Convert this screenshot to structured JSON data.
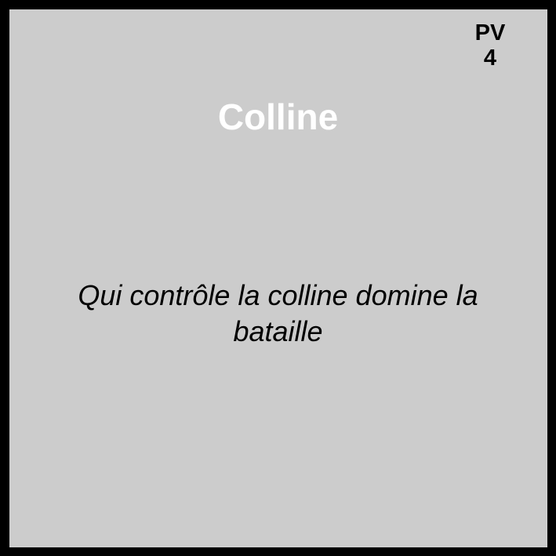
{
  "card": {
    "title": "Colline",
    "pv_label": "PV",
    "pv_value": "4",
    "flavor_text": "Qui contrôle la colline domine la bataille",
    "colors": {
      "border": "#000000",
      "background": "#cccccc",
      "title": "#ffffff"
    }
  }
}
